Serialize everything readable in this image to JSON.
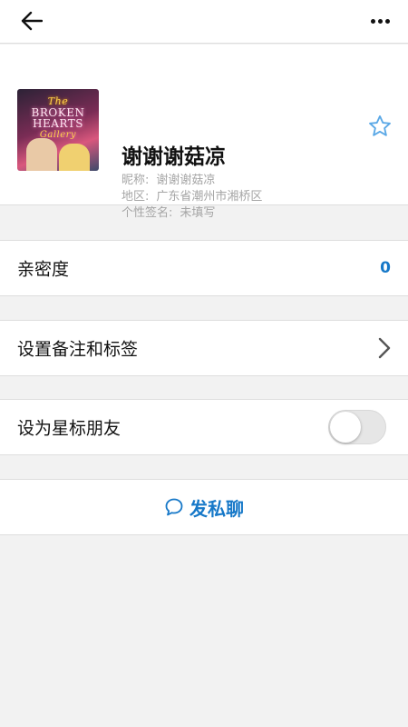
{
  "header": {
    "back_icon": "arrow-left-icon",
    "more_icon": "more-horizontal-icon"
  },
  "profile": {
    "avatar_text": {
      "line1": "The",
      "line2": "BROKEN",
      "line3": "HEARTS",
      "line4": "Gallery"
    },
    "name": "谢谢谢菇凉",
    "nickname_label": "昵称:",
    "nickname_value": "谢谢谢菇凉",
    "region_label": "地区:",
    "region_value": "广东省潮州市湘桥区",
    "signature_label": "个性签名:",
    "signature_value": "未填写",
    "star_icon": "star-outline-icon"
  },
  "intimacy": {
    "label": "亲密度",
    "value": "0"
  },
  "remark": {
    "label": "设置备注和标签",
    "icon": "chevron-right-icon"
  },
  "star_friend": {
    "label": "设为星标朋友",
    "enabled": false
  },
  "chat": {
    "label": "发私聊",
    "icon": "chat-bubble-icon"
  },
  "colors": {
    "accent": "#1678c8",
    "background": "#f2f2f2",
    "divider": "#dedede",
    "star": "#5aa8e6"
  }
}
